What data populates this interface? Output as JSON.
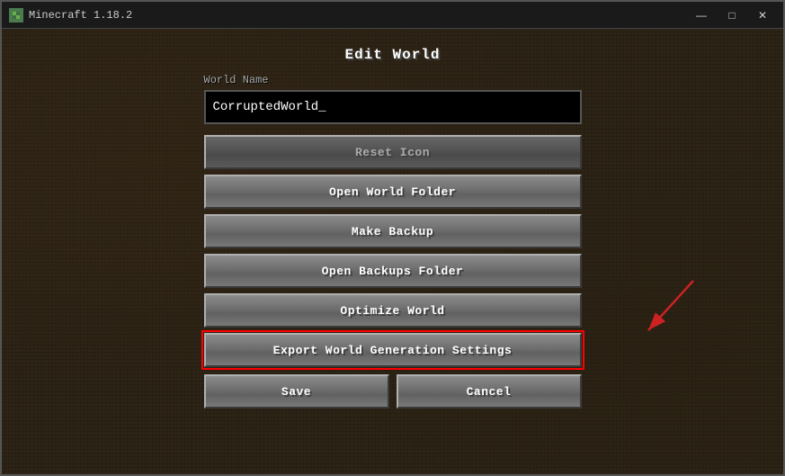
{
  "window": {
    "title": "Minecraft 1.18.2",
    "icon_label": "minecraft-icon",
    "controls": {
      "minimize": "—",
      "maximize": "□",
      "close": "✕"
    }
  },
  "dialog": {
    "title": "Edit World",
    "world_name_label": "World Name",
    "world_name_value": "CorruptedWorld_",
    "world_name_placeholder": "World Name",
    "buttons": {
      "reset_icon": "Reset Icon",
      "open_world_folder": "Open World Folder",
      "make_backup": "Make Backup",
      "open_backups_folder": "Open Backups Folder",
      "optimize_world": "Optimize World",
      "export_world_generation_settings": "Export World Generation Settings",
      "save": "Save",
      "cancel": "Cancel"
    }
  }
}
